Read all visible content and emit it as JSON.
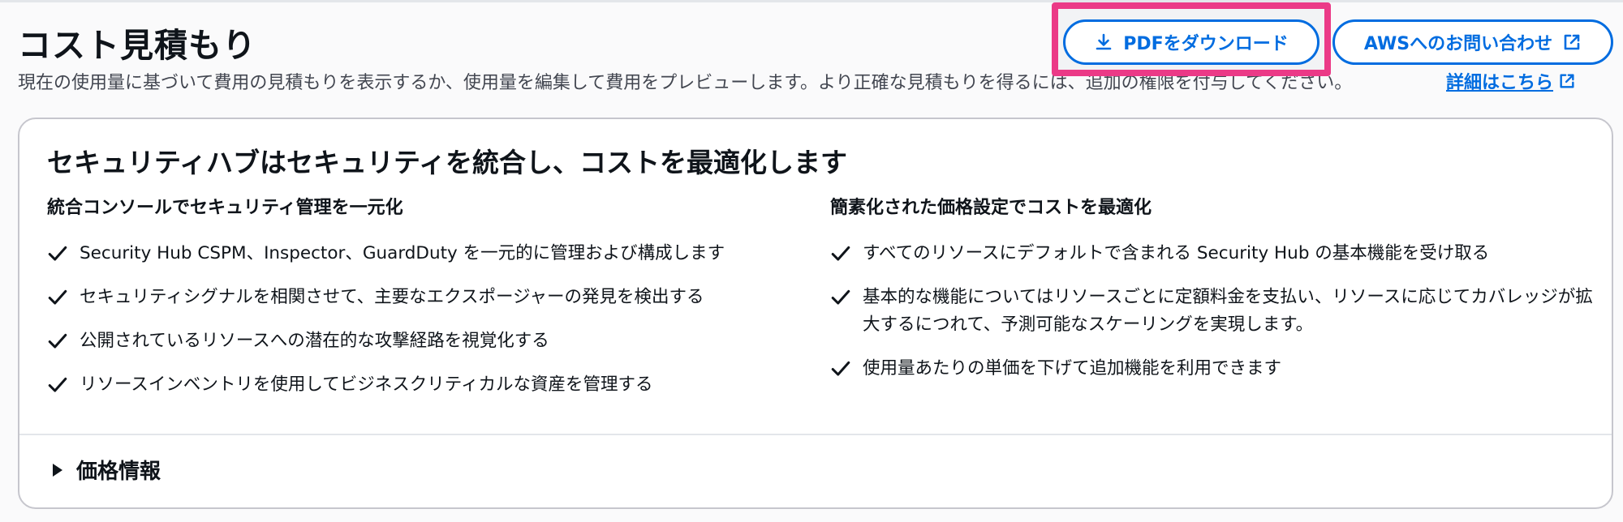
{
  "header": {
    "title": "コスト見積もり",
    "description": "現在の使用量に基づいて費用の見積もりを表示するか、使用量を編集して費用をプレビューします。より正確な見積もりを得るには、追加の権限を付与してください。",
    "learn_more": "詳細はこちら",
    "download_pdf": "PDFをダウンロード",
    "contact_aws": "AWSへのお問い合わせ"
  },
  "card": {
    "title": "セキュリティハブはセキュリティを統合し、コストを最適化します",
    "left": {
      "heading": "統合コンソールでセキュリティ管理を一元化",
      "items": [
        "Security Hub CSPM、Inspector、GuardDuty を一元的に管理および構成します",
        "セキュリティシグナルを相関させて、主要なエクスポージャーの発見を検出する",
        "公開されているリソースへの潜在的な攻撃経路を視覚化する",
        "リソースインベントリを使用してビジネスクリティカルな資産を管理する"
      ]
    },
    "right": {
      "heading": "簡素化された価格設定でコストを最適化",
      "items": [
        "すべてのリソースにデフォルトで含まれる Security Hub の基本機能を受け取る",
        "基本的な機能についてはリソースごとに定額料金を支払い、リソースに応じてカバレッジが拡大するにつれて、予測可能なスケーリングを実現します。",
        "使用量あたりの単価を下げて追加機能を利用できます"
      ]
    },
    "pricing_expander": "価格情報"
  },
  "colors": {
    "accent": "#006ce0",
    "highlight": "#eb3a87",
    "text": "#0f141a",
    "muted_text": "#424650",
    "border": "#c6c6cd"
  },
  "icons": {
    "download": "download-icon",
    "external": "external-link-icon",
    "check": "check-icon",
    "caret": "caret-right-icon"
  }
}
